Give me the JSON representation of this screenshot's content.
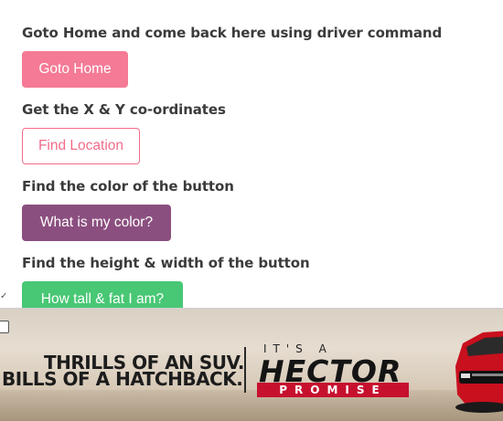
{
  "sections": [
    {
      "label": "Goto Home and come back here using driver command",
      "button": "Goto Home"
    },
    {
      "label": "Get the X & Y co-ordinates",
      "button": "Find Location"
    },
    {
      "label": "Find the color of the button",
      "button": "What is my color?"
    },
    {
      "label": "Find the height & width of the button",
      "button": "How tall & fat I am?"
    }
  ],
  "ad": {
    "line1": "THRILLS OF AN SUV.",
    "line2": "BILLS OF A HATCHBACK.",
    "its": "IT'S A",
    "brand": "HECTOR",
    "tagline": "PROMISE",
    "icon": "info-icon"
  },
  "colors": {
    "goto_home": "#f47a95",
    "find_location_border": "#f26b89",
    "color_button": "#8b4f7f",
    "size_button": "#48c774",
    "ad_accent": "#c6102e"
  }
}
